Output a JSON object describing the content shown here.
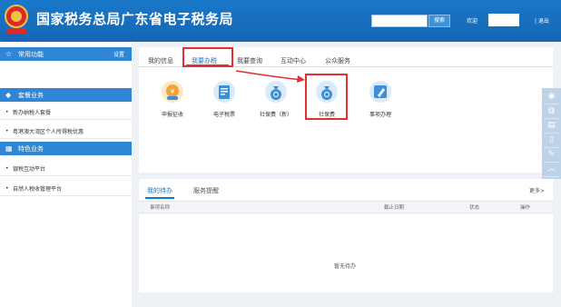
{
  "header": {
    "title": "国家税务总局广东省电子税务局",
    "search_button": "搜索",
    "welcome": "欢迎",
    "logout": "| 退出"
  },
  "sidebar": {
    "sections": [
      {
        "label": "常用功能",
        "extra": "设置",
        "icon": "star-icon"
      },
      {
        "label": "套餐业务",
        "icon": "diamond-icon"
      },
      {
        "label": "特色业务",
        "icon": "grid-icon"
      }
    ],
    "items": [
      {
        "label": "新办纳税人套餐"
      },
      {
        "label": "粤港澳大湾区个人所得税优惠"
      },
      {
        "label": "银税互动平台"
      },
      {
        "label": "自然人税收管理平台"
      }
    ]
  },
  "tabs": [
    {
      "label": "我的信息"
    },
    {
      "label": "我要办税"
    },
    {
      "label": "我要查询"
    },
    {
      "label": "互动中心"
    },
    {
      "label": "公众服务"
    }
  ],
  "functions": [
    {
      "label": "申报征收",
      "icon": "tax-declare-icon",
      "color": "#f0a43a"
    },
    {
      "label": "电子税票",
      "icon": "e-ticket-icon",
      "color": "#3e8fd6"
    },
    {
      "label": "社保费（新）",
      "icon": "money-bag-icon",
      "color": "#3e8fd6"
    },
    {
      "label": "社保费",
      "icon": "money-bag-icon",
      "color": "#3e8fd6"
    },
    {
      "label": "事项办理",
      "icon": "pencil-icon",
      "color": "#3e8fd6"
    }
  ],
  "todo": {
    "tabs": [
      {
        "label": "我的待办"
      },
      {
        "label": "服务提醒"
      }
    ],
    "more": "更多>",
    "columns": [
      "事项名称",
      "截止日期",
      "状态",
      "操作"
    ],
    "empty": "暂无待办"
  },
  "colors": {
    "header": "#1a78c8",
    "highlight": "#e03030",
    "accent": "#1677c9"
  }
}
